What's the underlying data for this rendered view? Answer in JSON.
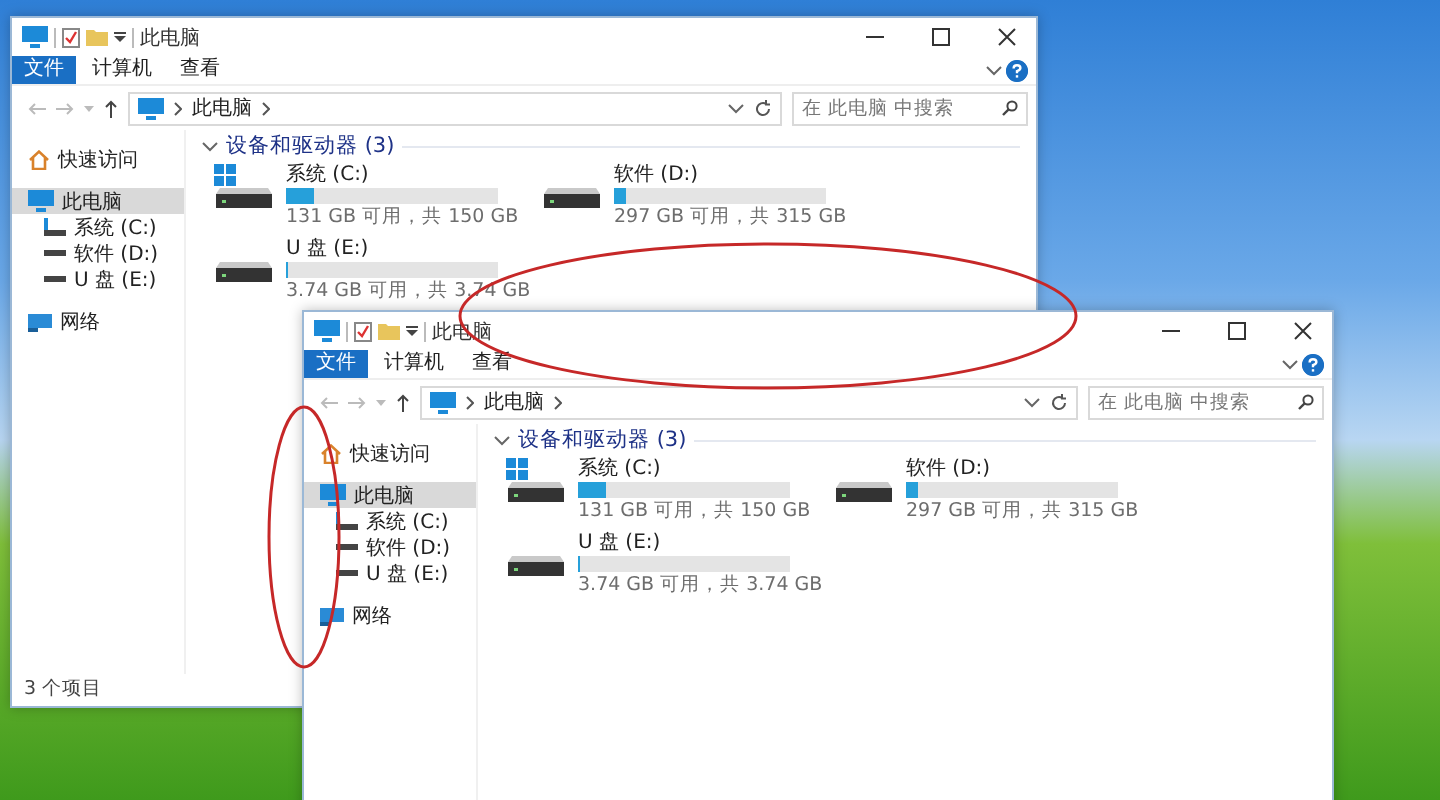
{
  "windows": [
    {
      "title": "此电脑",
      "ribbon_tabs": [
        {
          "label": "文件",
          "selected": true
        },
        {
          "label": "计算机",
          "selected": false
        },
        {
          "label": "查看",
          "selected": false
        }
      ],
      "address": {
        "path": [
          "此电脑"
        ]
      },
      "search": {
        "placeholder": "在 此电脑 中搜索"
      },
      "nav": [
        {
          "label": "快速访问",
          "kind": "quick",
          "selected": false
        },
        {
          "label": "此电脑",
          "kind": "pc",
          "selected": true,
          "children": [
            {
              "label": "系统 (C:)",
              "kind": "system",
              "selected": false
            },
            {
              "label": "软件 (D:)",
              "kind": "drive",
              "selected": false
            },
            {
              "label": "U 盘 (E:)",
              "kind": "drive",
              "selected": false
            }
          ]
        },
        {
          "label": "网络",
          "kind": "network",
          "selected": false
        }
      ],
      "section": {
        "title": "设备和驱动器 (3)",
        "expanded": true
      },
      "drives": [
        {
          "name": "系统 (C:)",
          "kind": "system",
          "level": 0.13,
          "space": "131 GB 可用，共 150 GB"
        },
        {
          "name": "软件 (D:)",
          "kind": "disk",
          "level": 0.06,
          "space": "297 GB 可用，共 315 GB"
        },
        {
          "name": "U 盘 (E:)",
          "kind": "disk",
          "level": 0,
          "space": "3.74 GB 可用，共 3.74 GB"
        }
      ],
      "status_bar": "3 个项目"
    },
    {
      "title": "此电脑",
      "ribbon_tabs": [
        {
          "label": "文件",
          "selected": true
        },
        {
          "label": "计算机",
          "selected": false
        },
        {
          "label": "查看",
          "selected": false
        }
      ],
      "address": {
        "path": [
          "此电脑"
        ]
      },
      "search": {
        "placeholder": "在 此电脑 中搜索"
      },
      "nav": [
        {
          "label": "快速访问",
          "kind": "quick",
          "selected": false
        },
        {
          "label": "此电脑",
          "kind": "pc",
          "selected": true,
          "children": [
            {
              "label": "系统 (C:)",
              "kind": "system",
              "selected": false
            },
            {
              "label": "软件 (D:)",
              "kind": "drive",
              "selected": false
            },
            {
              "label": "U 盘 (E:)",
              "kind": "drive",
              "selected": false
            }
          ]
        },
        {
          "label": "网络",
          "kind": "network",
          "selected": false
        }
      ],
      "section": {
        "title": "设备和驱动器 (3)",
        "expanded": true
      },
      "drives": [
        {
          "name": "系统 (C:)",
          "kind": "system",
          "level": 0.13,
          "space": "131 GB 可用，共 150 GB"
        },
        {
          "name": "软件 (D:)",
          "kind": "disk",
          "level": 0.06,
          "space": "297 GB 可用，共 315 GB"
        },
        {
          "name": "U 盘 (E:)",
          "kind": "disk",
          "level": 0,
          "space": "3.74 GB 可用，共 3.74 GB"
        }
      ]
    }
  ]
}
